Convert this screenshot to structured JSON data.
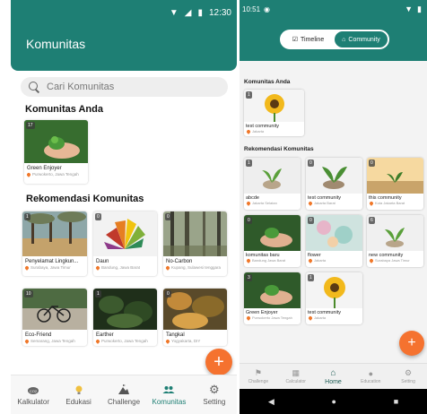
{
  "left": {
    "status": {
      "time": "12:30"
    },
    "title": "Komunitas",
    "search": {
      "placeholder": "Cari Komunitas"
    },
    "my_section": "Komunitas Anda",
    "my_communities": [
      {
        "name": "Green Enjoyer",
        "location": "Purwokerto, Jawa Tengah",
        "badge": "17"
      }
    ],
    "rec_section": "Rekomendasi Komunitas",
    "recommended": [
      {
        "name": "Penyelamat Lingkun...",
        "location": "Surabaya, Jawa Timur",
        "badge": "1"
      },
      {
        "name": "Daun",
        "location": "Bandung, Jawa Barat",
        "badge": "0"
      },
      {
        "name": "No-Carbon",
        "location": "Kupang, Sulawesi tenggara",
        "badge": "0"
      },
      {
        "name": "Eco-Friend",
        "location": "Semarang, Jawa Tengah",
        "badge": "10"
      },
      {
        "name": "Earther",
        "location": "Purwokerto, Jawa Tengah",
        "badge": "1"
      },
      {
        "name": "Tangkal",
        "location": "Yogyakarta, DIY",
        "badge": "0"
      }
    ],
    "fab": "+",
    "nav": [
      {
        "label": "Kalkulator",
        "icon": "co2-icon"
      },
      {
        "label": "Edukasi",
        "icon": "lightbulb-icon"
      },
      {
        "label": "Challenge",
        "icon": "mountain-flag-icon"
      },
      {
        "label": "Komunitas",
        "icon": "people-icon"
      },
      {
        "label": "Setting",
        "icon": "gear-icon"
      }
    ]
  },
  "right": {
    "status": {
      "time": "10:51"
    },
    "toggle": {
      "timeline": "Timeline",
      "community": "Community"
    },
    "my_section": "Komunitas Anda",
    "my_communities": [
      {
        "name": "test community",
        "location": "Jakarta",
        "badge": "1"
      }
    ],
    "rec_section": "Rekomendasi Komunitas",
    "recommended": [
      {
        "name": "abcde",
        "location": "Jakarta Selatan",
        "badge": "1"
      },
      {
        "name": "test community",
        "location": "Jakarta Barat",
        "badge": "0"
      },
      {
        "name": "this community",
        "location": "Kota Jakarta Barat",
        "badge": "0"
      },
      {
        "name": "komunitas baru",
        "location": "Bandung Jawa Barat",
        "badge": "0"
      },
      {
        "name": "flower",
        "location": "Jakarta",
        "badge": "0"
      },
      {
        "name": "new community",
        "location": "Surabaya Jawa Timur",
        "badge": "6"
      },
      {
        "name": "Green Enjoyer",
        "location": "Purwokerto Jawa Tengah",
        "badge": "3"
      },
      {
        "name": "test community",
        "location": "Jakarta",
        "badge": "1"
      }
    ],
    "fab": "+",
    "nav": [
      {
        "label": "Challenge",
        "icon": "flag-icon"
      },
      {
        "label": "Calculator",
        "icon": "calculator-icon"
      },
      {
        "label": "Home",
        "icon": "home-icon"
      },
      {
        "label": "Education",
        "icon": "lightbulb-icon"
      },
      {
        "label": "Setting",
        "icon": "gear-icon"
      }
    ]
  }
}
